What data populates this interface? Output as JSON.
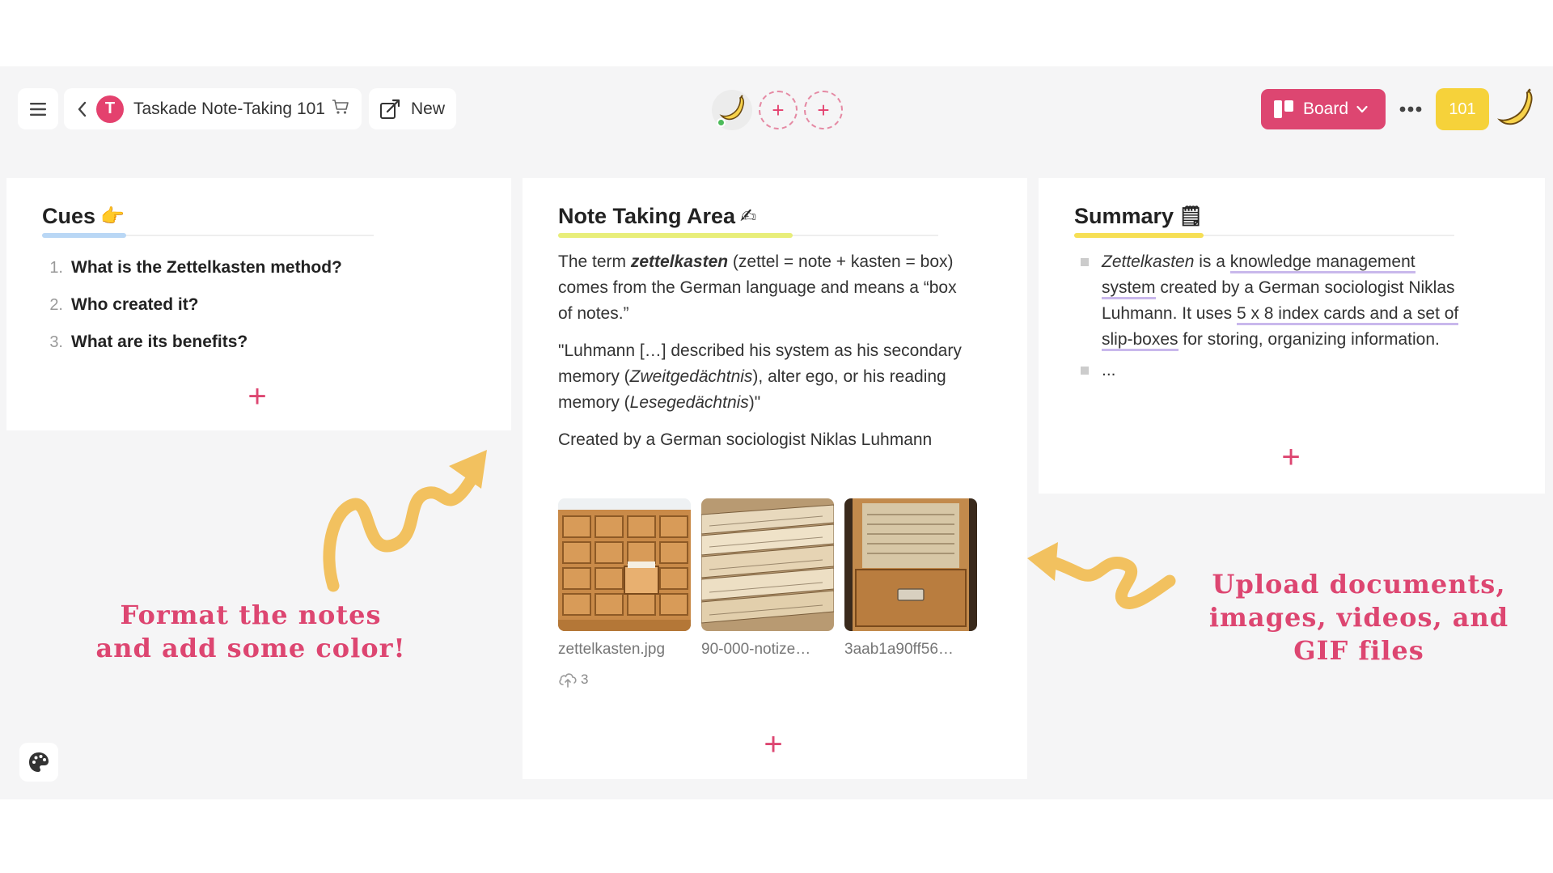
{
  "topbar": {
    "menu_icon": "hamburger-icon",
    "breadcrumb": {
      "avatar_letter": "T",
      "title": "Taskade Note-Taking 101",
      "title_icon": "cart-icon"
    },
    "new_label": "New",
    "board_label": "Board",
    "count_badge": "101"
  },
  "columns": {
    "cues": {
      "title": "Cues",
      "title_emoji": "👉",
      "items": [
        {
          "num": "1.",
          "text": "What is the Zettelkasten method?"
        },
        {
          "num": "2.",
          "text": "Who created it?"
        },
        {
          "num": "3.",
          "text": "What are its benefits?"
        }
      ]
    },
    "notes": {
      "title": "Note Taking Area",
      "title_emoji": "✍",
      "p1_a": "The  term ",
      "p1_em": "zettelkasten",
      "p1_b": " (zettel = note + kasten = box) comes from the German language and means a “box of notes.”",
      "p2_a": "\"Luhmann […] described his system as his secondary memory (",
      "p2_i1": "Zweitgedächtnis",
      "p2_b": "), alter ego, or his reading memory (",
      "p2_i2": "Lesegedächtnis",
      "p2_c": ")\"",
      "p3": "Created by a German sociologist Niklas Luhmann",
      "files": [
        {
          "name": "zettelkasten.jpg"
        },
        {
          "name": "90-000-notize…"
        },
        {
          "name": "3aab1a90ff56…"
        }
      ],
      "upload_count": "3"
    },
    "summary": {
      "title": "Summary",
      "title_emoji": "🗒",
      "s1_em": "Zettelkasten",
      "s1_a": " is a ",
      "s1_link1": "knowledge management system",
      "s1_b": " created by a German sociologist Niklas Luhmann. It uses ",
      "s1_link2": "5 x 8 index cards and a set of slip-boxes",
      "s1_c": " for storing, organizing information.",
      "s2": "..."
    }
  },
  "annotations": {
    "left": "Format the notes and add some color!",
    "right": "Upload documents, images, videos, and GIF files"
  },
  "colors": {
    "accent": "#dd4671",
    "badge": "#f6d23a",
    "arrow": "#f2c15f",
    "cues_underline": "#b9d7f5",
    "notes_underline": "#e8ee7a",
    "summary_underline": "#f6df55",
    "link_underline": "#c9b8ec"
  }
}
